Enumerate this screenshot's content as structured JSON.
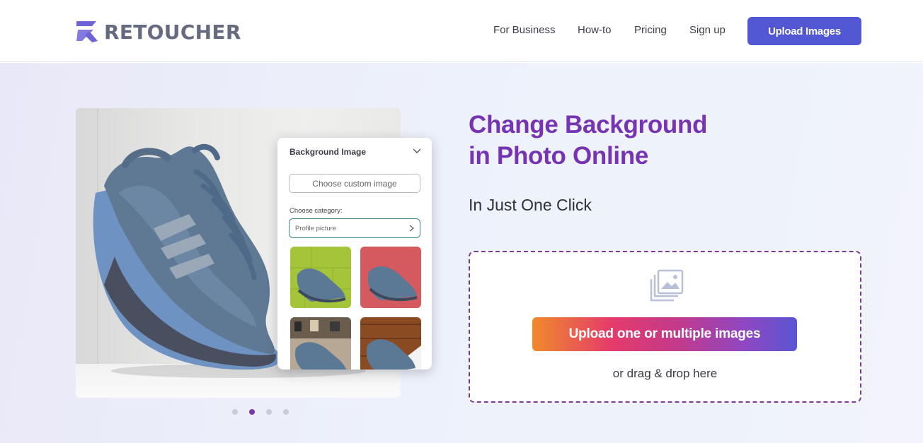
{
  "header": {
    "logo_text": "RETOUCHER",
    "nav": [
      "For Business",
      "How-to",
      "Pricing",
      "Sign up"
    ],
    "upload_label": "Upload Images"
  },
  "hero": {
    "headline_line1": "Change Background",
    "headline_line2": "in Photo Online",
    "subheadline": "In Just One Click"
  },
  "panel": {
    "title": "Background Image",
    "custom_button": "Choose custom image",
    "category_label": "Choose category:",
    "category_value": "Profile picture"
  },
  "carousel": {
    "slide_count": 4,
    "active_index": 1
  },
  "dropzone": {
    "button_label": "Upload one or multiple images",
    "hint": "or drag & drop here"
  },
  "colors": {
    "brand": "#5258d4",
    "headline": "#7634b3",
    "dashed_border": "#7c3a94",
    "gradient_start": "#f08a2c",
    "gradient_end": "#5b55d3"
  },
  "icons": [
    "logo-mark-icon",
    "chevron-down-icon",
    "chevron-right-icon",
    "image-gallery-icon"
  ]
}
